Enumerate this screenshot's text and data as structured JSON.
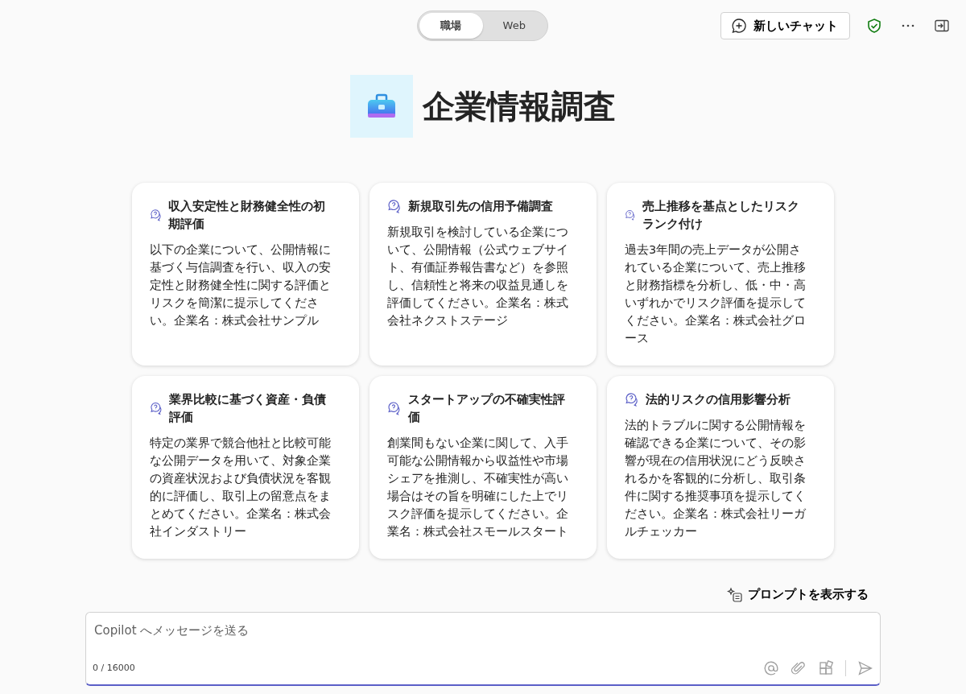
{
  "mode_toggle": [
    {
      "label": "職場",
      "selected": true
    },
    {
      "label": "Web",
      "selected": false
    }
  ],
  "header": {
    "new_chat": "新しいチャット"
  },
  "agent": {
    "title": "企業情報調査"
  },
  "prompt_cards": [
    {
      "title": "収入安定性と財務健全性の初期評価",
      "body": "以下の企業について、公開情報に基づく与信調査を行い、収入の安定性と財務健全性に関する評価とリスクを簡潔に提示してください。企業名：株式会社サンプル"
    },
    {
      "title": "新規取引先の信用予備調査",
      "body": "新規取引を検討している企業について、公開情報（公式ウェブサイト、有価証券報告書など）を参照し、信頼性と将来の収益見通しを評価してください。企業名：株式会社ネクストステージ"
    },
    {
      "title": "売上推移を基点としたリスクランク付け",
      "body": "過去3年間の売上データが公開されている企業について、売上推移と財務指標を分析し、低・中・高いずれかでリスク評価を提示してください。企業名：株式会社グロース"
    },
    {
      "title": "業界比較に基づく資産・負債評価",
      "body": "特定の業界で競合他社と比較可能な公開データを用いて、対象企業の資産状況および負債状況を客観的に評価し、取引上の留意点をまとめてください。企業名：株式会社インダストリー"
    },
    {
      "title": "スタートアップの不確実性評価",
      "body": "創業間もない企業に関して、入手可能な公開情報から収益性や市場シェアを推測し、不確実性が高い場合はその旨を明確にした上でリスク評価を提示してください。企業名：株式会社スモールスタート"
    },
    {
      "title": "法的リスクの信用影響分析",
      "body": "法的トラブルに関する公開情報を確認できる企業について、その影響が現在の信用状況にどう反映されるかを客観的に分析し、取引条件に関する推奨事項を提示してください。企業名：株式会社リーガルチェッカー"
    }
  ],
  "show_prompts": "プロンプトを表示する",
  "composer": {
    "placeholder": "Copilot へメッセージを送る",
    "counter": "0 / 16000"
  }
}
